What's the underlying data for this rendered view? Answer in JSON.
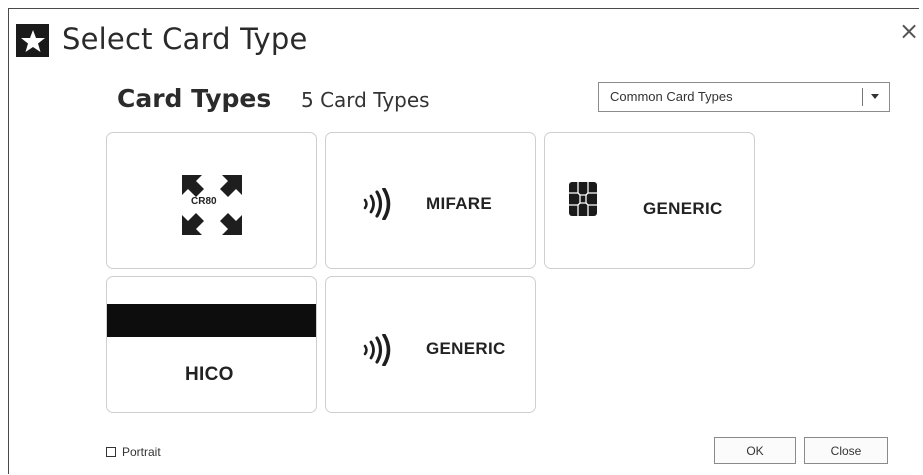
{
  "window": {
    "title": "Select Card Type",
    "close_glyph": "×"
  },
  "header": {
    "heading": "Card Types",
    "count": "5 Card Types"
  },
  "filter": {
    "selected": "Common Card Types"
  },
  "cards": [
    {
      "name": "cr80",
      "icon": "expand-arrows-icon",
      "badge": "CR80",
      "label": ""
    },
    {
      "name": "mifare",
      "icon": "contactless-icon",
      "label": "MIFARE"
    },
    {
      "name": "generic-contact",
      "icon": "chip-icon",
      "label": "GENERIC"
    },
    {
      "name": "hico",
      "icon": "magnetic-stripe-icon",
      "label": "HICO"
    },
    {
      "name": "generic-contactless",
      "icon": "contactless-icon",
      "label": "GENERIC"
    }
  ],
  "footer": {
    "portrait_label": "Portrait",
    "portrait_checked": false,
    "ok_label": "OK",
    "close_label": "Close"
  }
}
